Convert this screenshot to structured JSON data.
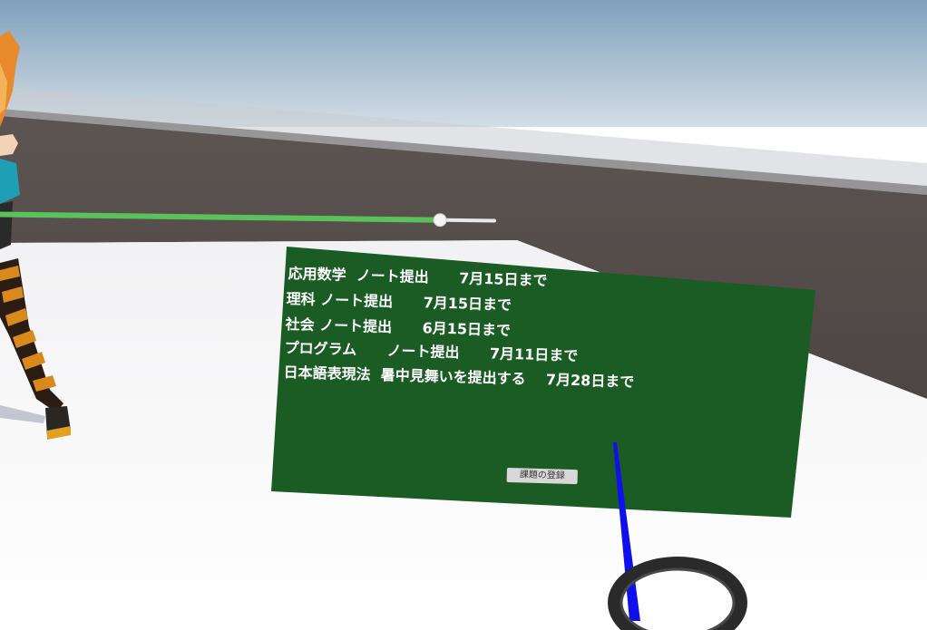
{
  "tasks": [
    {
      "subject": "応用数学",
      "task": "ノート提出",
      "due": "7月15日まで"
    },
    {
      "subject": "理科",
      "task": "ノート提出",
      "due": "7月15日まで"
    },
    {
      "subject": "社会",
      "task": "ノート提出",
      "due": "6月15日まで"
    },
    {
      "subject": "プログラム",
      "task": "ノート提出",
      "due": "7月11日まで"
    },
    {
      "subject": "日本語表現法",
      "task": "暑中見舞いを提出する",
      "due": "7月28日まで"
    }
  ],
  "register_button_label": "課題の登録",
  "slider": {
    "value": 0.89
  },
  "colors": {
    "board": "#1a5c24",
    "slider_fill": "#5bc25b",
    "pointer_ray": "#1010ee",
    "controller_ring": "#2a2a2a"
  },
  "icons": [
    "vr-controller-ring-icon",
    "avatar-character"
  ]
}
